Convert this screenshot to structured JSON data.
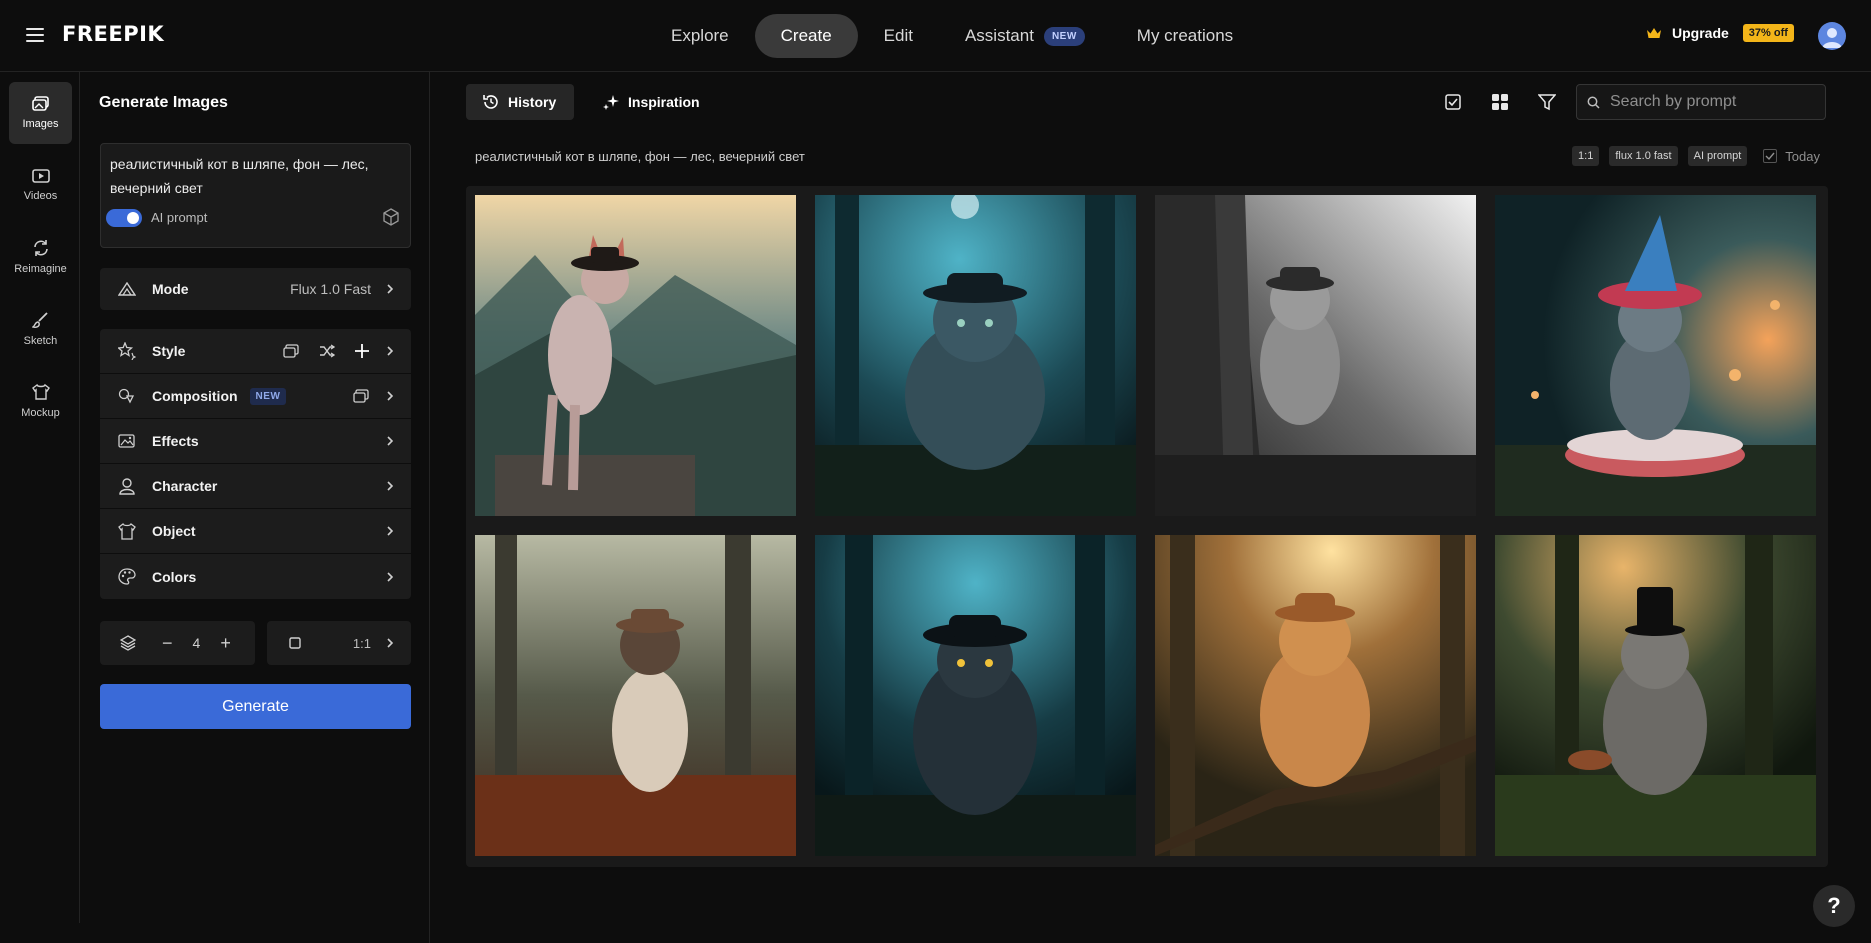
{
  "brand": {
    "logo": "FREEPIK"
  },
  "nav": {
    "items": [
      {
        "label": "Explore"
      },
      {
        "label": "Create"
      },
      {
        "label": "Edit"
      },
      {
        "label": "Assistant",
        "badge": "NEW"
      },
      {
        "label": "My creations"
      }
    ],
    "active": "Create"
  },
  "account": {
    "upgrade_label": "Upgrade",
    "discount": "37% off"
  },
  "rail": {
    "items": [
      {
        "label": "Images",
        "icon": "images-icon"
      },
      {
        "label": "Videos",
        "icon": "videos-icon"
      },
      {
        "label": "Reimagine",
        "icon": "reimagine-icon"
      },
      {
        "label": "Sketch",
        "icon": "sketch-icon"
      },
      {
        "label": "Mockup",
        "icon": "mockup-icon"
      }
    ]
  },
  "panel": {
    "title": "Generate Images",
    "prompt": "реалистичный кот в шляпе, фон — лес, вечерний свет",
    "ai_prompt_label": "AI prompt",
    "ai_prompt_enabled": true,
    "mode": {
      "label": "Mode",
      "value": "Flux 1.0 Fast"
    },
    "settings": [
      {
        "label": "Style"
      },
      {
        "label": "Composition",
        "badge": "NEW"
      },
      {
        "label": "Effects"
      },
      {
        "label": "Character"
      },
      {
        "label": "Object"
      },
      {
        "label": "Colors"
      }
    ],
    "quantity": "4",
    "aspect_ratio": "1:1",
    "generate_label": "Generate"
  },
  "main": {
    "tabs": [
      {
        "label": "History"
      },
      {
        "label": "Inspiration"
      }
    ],
    "active_tab": "History",
    "search_placeholder": "Search by prompt",
    "result_prompt": "реалистичный кот в шляпе, фон — лес, вечерний свет",
    "chips": [
      "1:1",
      "flux 1.0 fast",
      "AI prompt"
    ],
    "today_label": "Today"
  },
  "colors": {
    "accent": "#3a6ad8",
    "discount": "#f3b519",
    "background": "#0d0d0d"
  },
  "help_label": "?"
}
